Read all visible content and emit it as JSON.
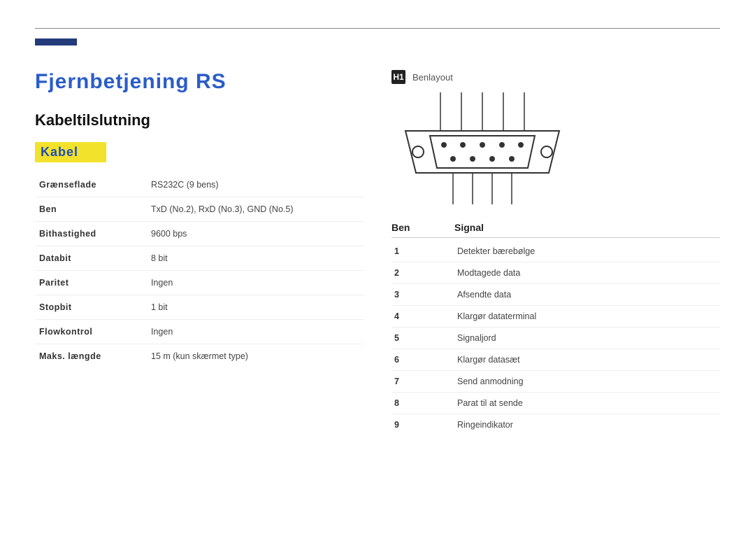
{
  "header": {},
  "title": "Fjernbetjening RS",
  "section_cable": {
    "heading": "Kabeltilslutning",
    "subheading": "Kabel",
    "rows": [
      {
        "label": "Grænseflade",
        "value": "RS232C (9 bens)"
      },
      {
        "label": "Ben",
        "value": "TxD (No.2), RxD (No.3), GND (No.5)"
      },
      {
        "label": "Bithastighed",
        "value": "9600 bps"
      },
      {
        "label": "Databit",
        "value": "8 bit"
      },
      {
        "label": "Paritet",
        "value": "Ingen"
      },
      {
        "label": "Stopbit",
        "value": "1 bit"
      },
      {
        "label": "Flowkontrol",
        "value": "Ingen"
      },
      {
        "label": "Maks. længde",
        "value": "15 m (kun skærmet type)"
      }
    ]
  },
  "pinlayout": {
    "key": "H1",
    "text": "Benlayout"
  },
  "signal": {
    "header_pin": "Ben",
    "header_signal": "Signal",
    "rows": [
      {
        "pin": "1",
        "name": "Detekter bærebølge"
      },
      {
        "pin": "2",
        "name": "Modtagede data"
      },
      {
        "pin": "3",
        "name": "Afsendte data"
      },
      {
        "pin": "4",
        "name": "Klargør dataterminal"
      },
      {
        "pin": "5",
        "name": "Signaljord"
      },
      {
        "pin": "6",
        "name": "Klargør datasæt"
      },
      {
        "pin": "7",
        "name": "Send anmodning"
      },
      {
        "pin": "8",
        "name": "Parat til at sende"
      },
      {
        "pin": "9",
        "name": "Ringeindikator"
      }
    ]
  }
}
